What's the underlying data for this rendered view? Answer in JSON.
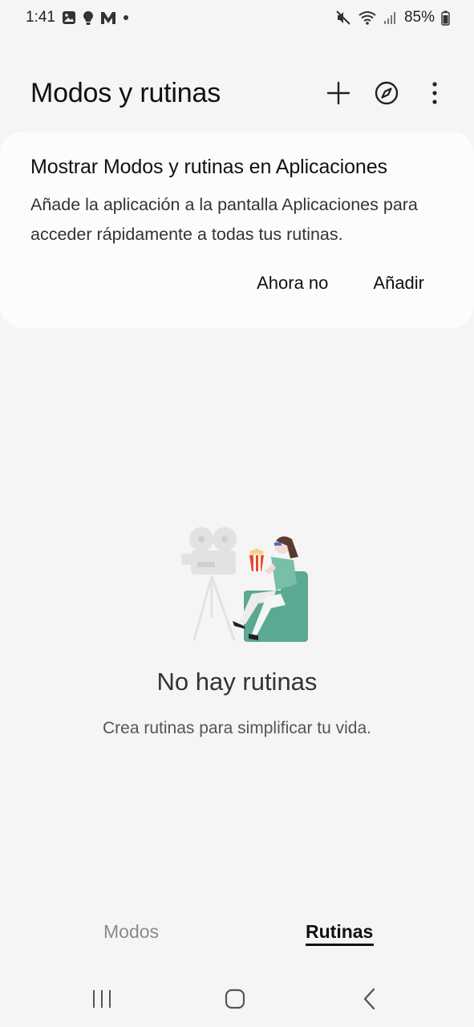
{
  "status_bar": {
    "time": "1:41",
    "battery": "85%"
  },
  "header": {
    "title": "Modos y rutinas"
  },
  "card": {
    "title": "Mostrar Modos y rutinas en Aplicaciones",
    "description": "Añade la aplicación a la pantalla Aplicaciones para acceder rápidamente a todas tus rutinas.",
    "dismiss_label": "Ahora no",
    "add_label": "Añadir"
  },
  "empty_state": {
    "title": "No hay rutinas",
    "subtitle": "Crea rutinas para simplificar tu vida."
  },
  "tabs": [
    {
      "label": "Modos",
      "selected": false
    },
    {
      "label": "Rutinas",
      "selected": true
    }
  ],
  "colors": {
    "background": "#f5f5f5",
    "card": "#fcfcfc",
    "chair": "#5aa993",
    "popcorn": "#e8472f"
  },
  "icons": {
    "status_left": [
      "gallery-icon",
      "bulb-icon",
      "m-app-icon",
      "dot-icon"
    ],
    "status_right": [
      "mute-icon",
      "wifi-icon",
      "signal-icon",
      "battery-icon"
    ],
    "header": [
      "plus-icon",
      "compass-icon",
      "more-vert-icon"
    ],
    "nav": [
      "recents-icon",
      "home-icon",
      "back-icon"
    ]
  }
}
